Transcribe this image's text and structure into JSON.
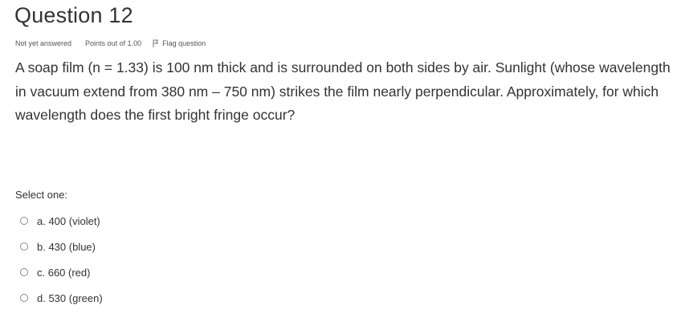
{
  "question": {
    "title": "Question 12",
    "status": "Not yet answered",
    "points": "Points out of 1.00",
    "flag_label": "Flag question",
    "text": "A soap film (n = 1.33) is 100 nm thick and is surrounded on both sides by air. Sunlight (whose wavelength in vacuum extend from 380 nm – 750 nm) strikes the film nearly perpendicular. Approximately, for which wavelength does the first bright fringe occur?",
    "prompt": "Select one:",
    "options": [
      {
        "label": "a. 400 (violet)"
      },
      {
        "label": "b. 430 (blue)"
      },
      {
        "label": "c. 660 (red)"
      },
      {
        "label": "d. 530 (green)"
      }
    ]
  },
  "icons": {
    "flag": "flag-icon",
    "radio": "radio-unchecked-icon"
  }
}
